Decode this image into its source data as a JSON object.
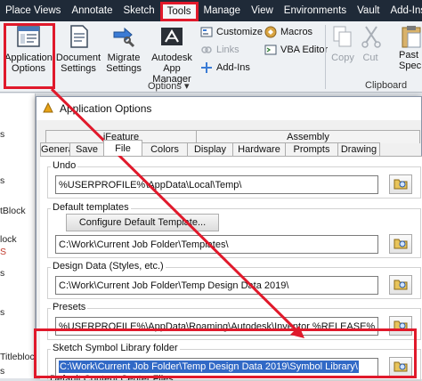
{
  "ribbon_tabs": [
    "Place Views",
    "Annotate",
    "Sketch",
    "Tools",
    "Manage",
    "View",
    "Environments",
    "Vault",
    "Add-Ins"
  ],
  "ribbon_active_tab": "Tools",
  "options_group": {
    "buttons": [
      {
        "label1": "Application",
        "label2": "Options",
        "icon": "application-options-icon"
      },
      {
        "label1": "Document",
        "label2": "Settings",
        "icon": "document-settings-icon"
      },
      {
        "label1": "Migrate",
        "label2": "Settings",
        "icon": "migrate-settings-icon"
      },
      {
        "label1": "Autodesk",
        "label2": "App Manager",
        "icon": "app-manager-icon"
      }
    ],
    "small": [
      {
        "label": "Customize",
        "disabled": false
      },
      {
        "label": "Links",
        "disabled": true
      },
      {
        "label": "Add-Ins",
        "disabled": false
      },
      {
        "label": "Macros",
        "disabled": false
      },
      {
        "label": "VBA Editor",
        "disabled": false
      }
    ],
    "label": "Options"
  },
  "clipboard_group": {
    "copy": "Copy",
    "cut": "Cut",
    "paste1": "Past",
    "paste2": "Spec",
    "label": "Clipboard"
  },
  "left_strip": [
    "s",
    "s",
    "tBlock",
    "lock",
    "S",
    "s",
    "s",
    "Titleblock",
    "s"
  ],
  "dialog": {
    "title": "Application Options",
    "tabs_top": [
      "iFeature",
      "Assembly"
    ],
    "tabs_bottom": [
      "General",
      "Save",
      "File",
      "Colors",
      "Display",
      "Hardware",
      "Prompts",
      "Drawing"
    ],
    "selected_tab": "File",
    "undo": {
      "label": "Undo",
      "value": "%USERPROFILE%\\AppData\\Local\\Temp\\"
    },
    "default_templates": {
      "label": "Default templates",
      "button": "Configure Default Template...",
      "value": "C:\\Work\\Current Job Folder\\Templates\\"
    },
    "design_data": {
      "label": "Design Data (Styles, etc.)",
      "value": "C:\\Work\\Current Job Folder\\Temp Design Data 2019\\"
    },
    "presets": {
      "label": "Presets",
      "value": "%USERPROFILE%\\AppData\\Roaming\\Autodesk\\Inventor %RELEASE%\\Presets\\"
    },
    "sketch_symbol": {
      "label": "Sketch Symbol Library folder",
      "value": "C:\\Work\\Current Job Folder\\Temp Design Data 2019\\Symbol Library\\"
    },
    "next_label": "Default Content Center Files"
  },
  "colors": {
    "accent_red": "#e0192b",
    "ribbon_dark": "#1f2a38",
    "selection_blue": "#3169c6"
  }
}
